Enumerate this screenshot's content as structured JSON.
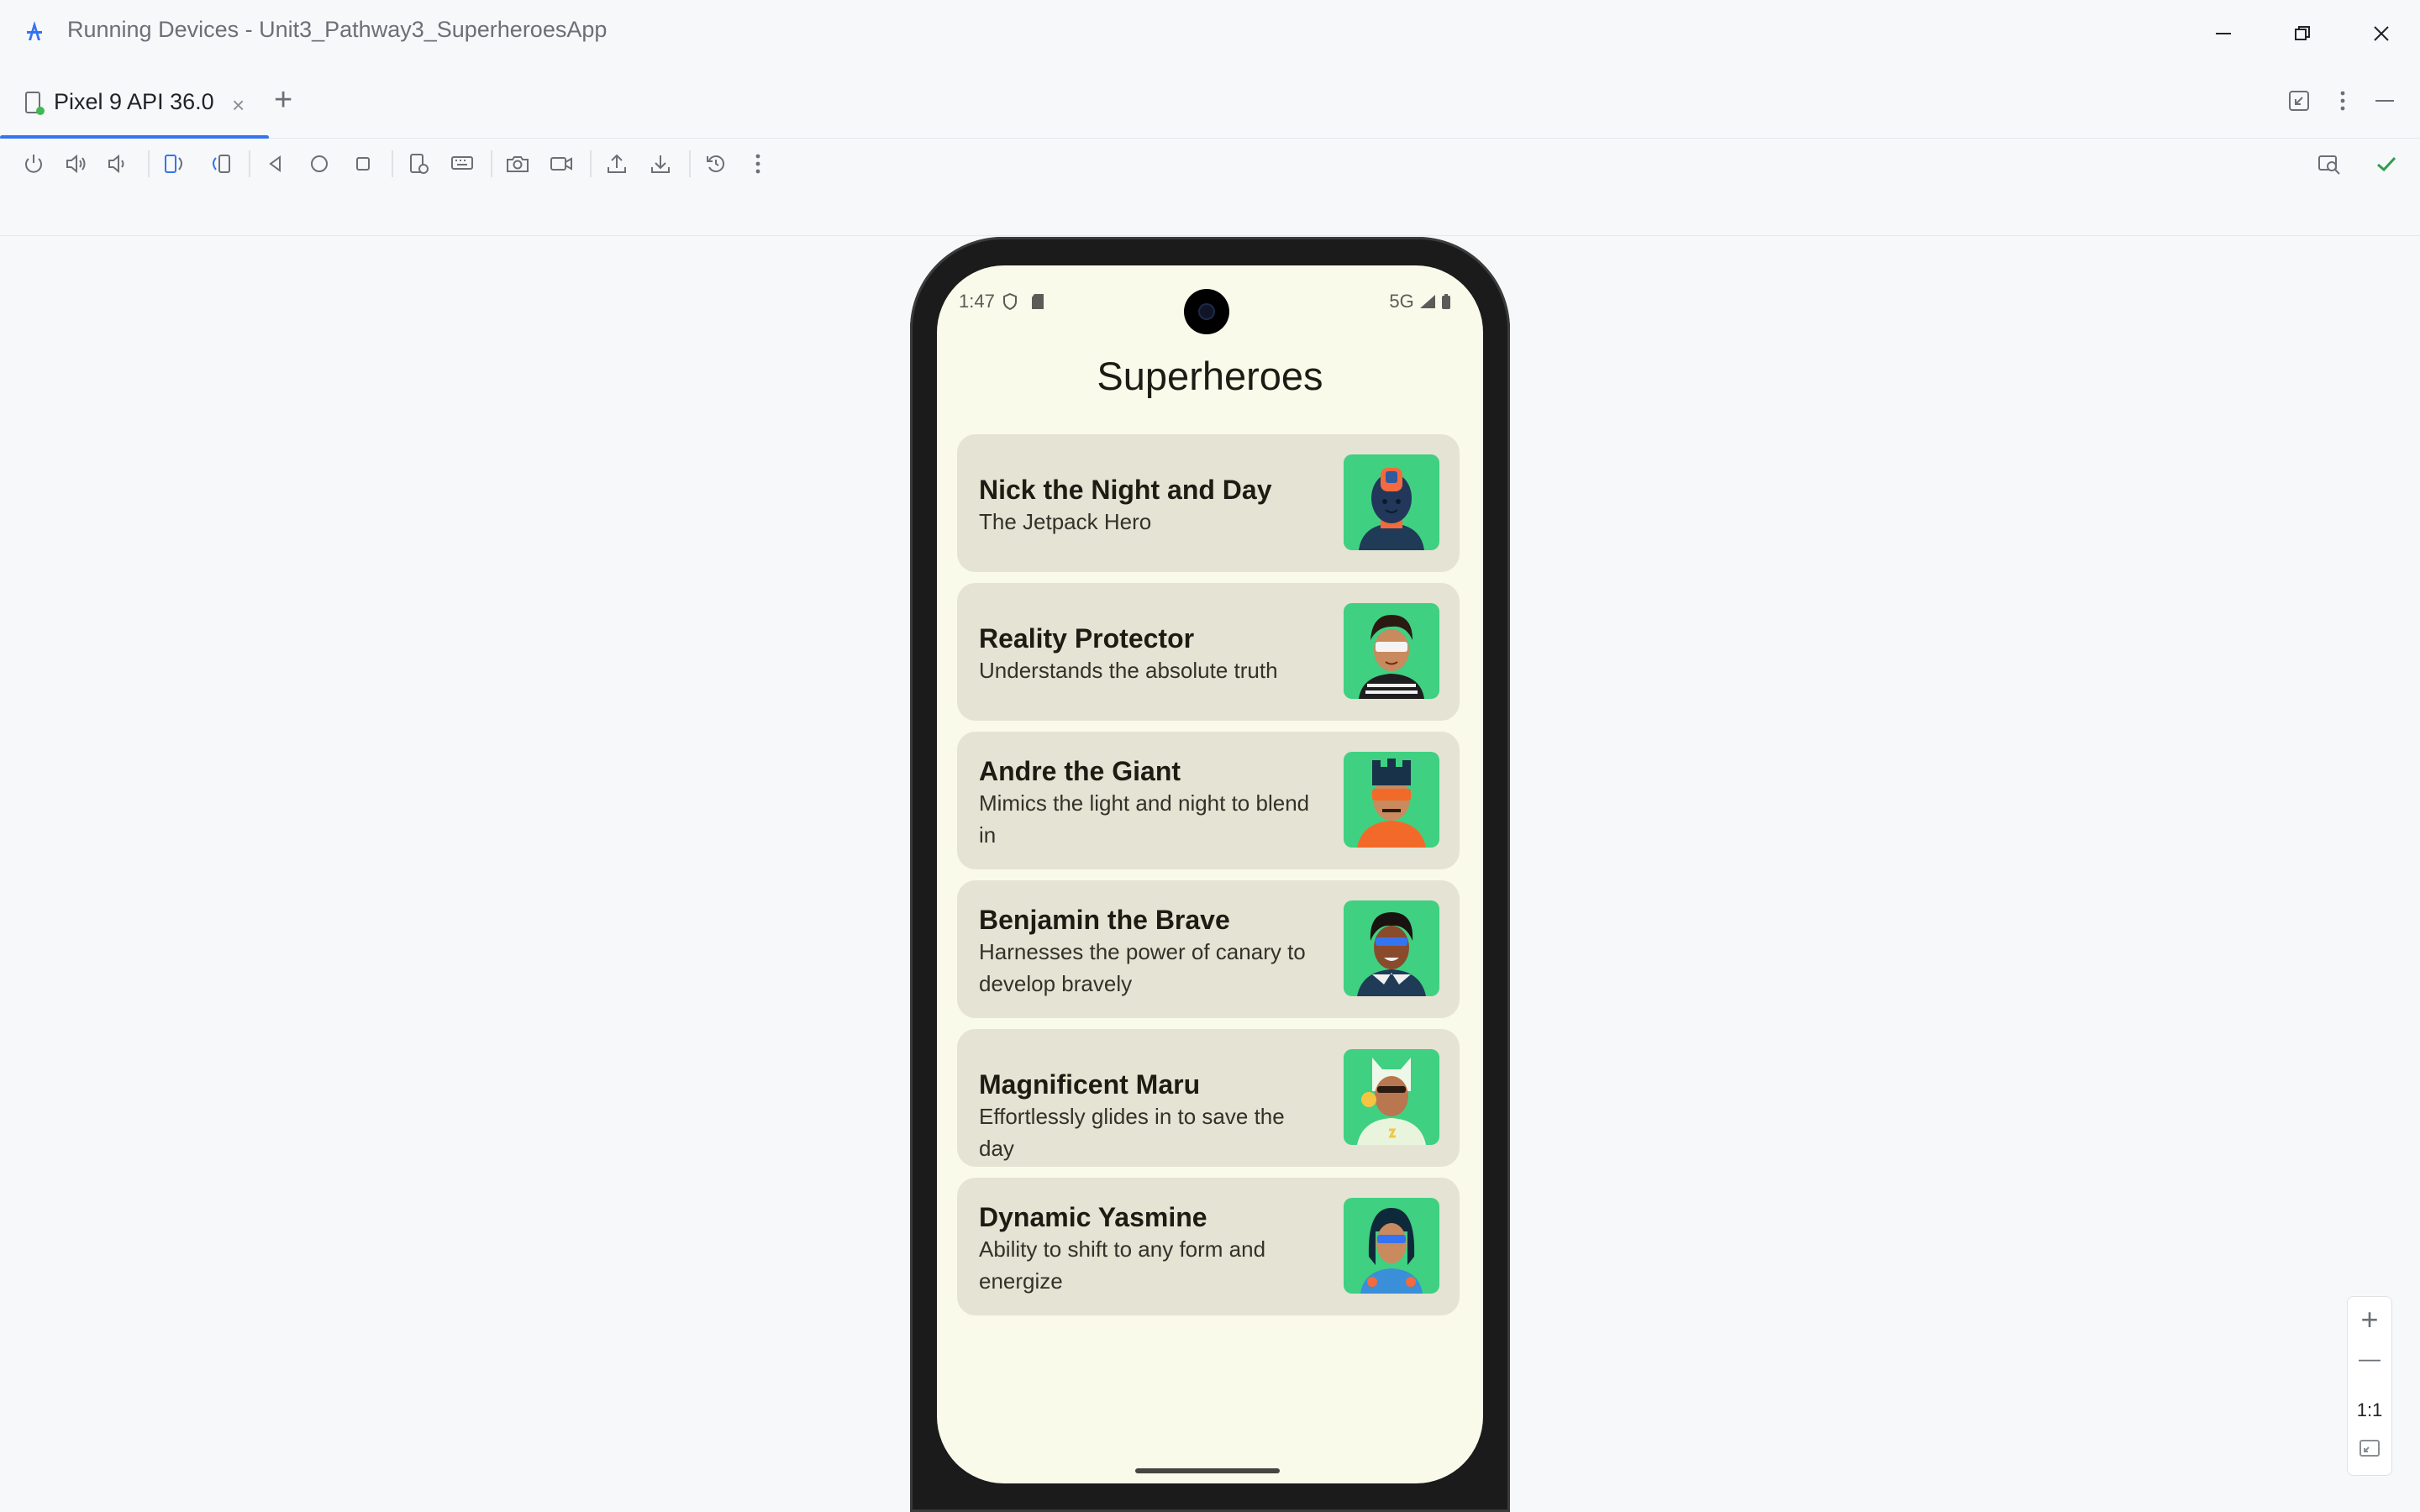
{
  "window": {
    "title": "Running Devices - Unit3_Pathway3_SuperheroesApp",
    "controls": [
      "minimize-icon",
      "restore-icon",
      "close-icon"
    ]
  },
  "tabs": [
    {
      "label": "Pixel 9 API 36.0",
      "icon": "device-icon",
      "active": true
    }
  ],
  "toolbar": {
    "buttons": [
      "power-icon",
      "volume-up-icon",
      "volume-down-icon",
      "rotate-left-icon",
      "rotate-right-icon",
      "back-icon",
      "home-icon",
      "overview-icon",
      "device-settings-icon",
      "keyboard-icon",
      "screenshot-icon",
      "screen-record-icon",
      "push-icon",
      "pull-icon",
      "reset-icon",
      "more-icon"
    ],
    "right": [
      "inspect-icon",
      "check-icon"
    ]
  },
  "device": {
    "status_time": "1:47",
    "status_network": "5G",
    "app_title": "Superheroes",
    "heroes": [
      {
        "name": "Nick the Night and Day",
        "description": "The Jetpack Hero"
      },
      {
        "name": "Reality Protector",
        "description": "Understands the absolute truth"
      },
      {
        "name": "Andre the Giant",
        "description": "Mimics the light and night to blend in"
      },
      {
        "name": "Benjamin the Brave",
        "description": "Harnesses the power of canary to develop bravely"
      },
      {
        "name": "Magnificent Maru",
        "description": "Effortlessly glides in to save the day"
      },
      {
        "name": "Dynamic Yasmine",
        "description": "Ability to shift to any form and energize"
      }
    ]
  },
  "zoom_controls": {
    "zoom_in": "+",
    "zoom_out": "—",
    "actual_size": "1:1"
  },
  "colors": {
    "accent": "#3574f0",
    "screen_bg": "#fafaeb",
    "card_bg": "#e5e3d3",
    "avatar_bg": "#3fd082",
    "check": "#2e9e4f"
  }
}
